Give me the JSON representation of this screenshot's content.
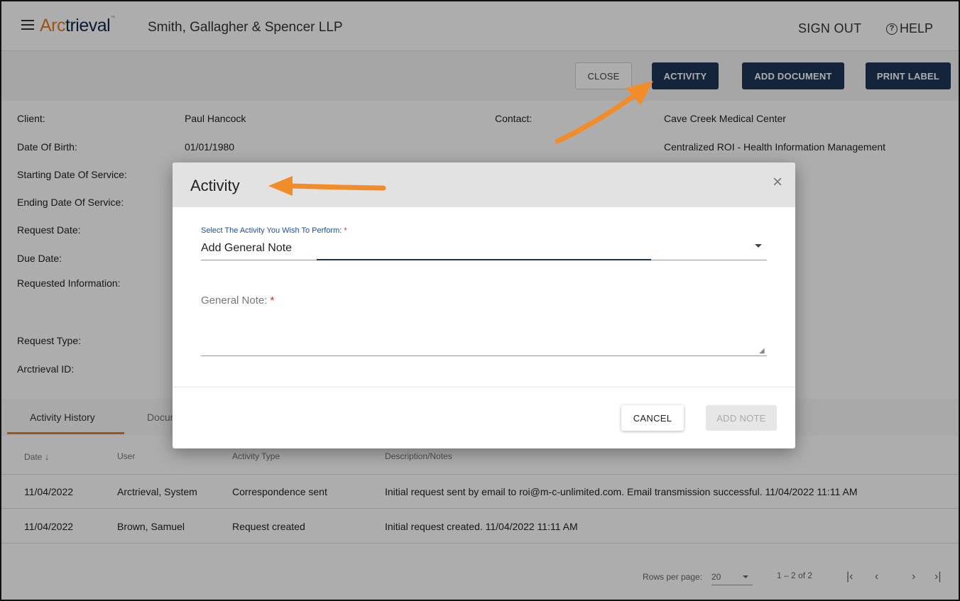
{
  "app": {
    "logo_part1": "Arc",
    "logo_part2": "trieval",
    "firm_name": "Smith, Gallagher & Spencer LLP",
    "sign_out": "SIGN OUT",
    "help": "HELP"
  },
  "actions": {
    "close": "CLOSE",
    "activity": "ACTIVITY",
    "add_document": "ADD DOCUMENT",
    "print_label": "PRINT LABEL"
  },
  "info": {
    "client_label": "Client:",
    "client_value": "Paul Hancock",
    "dob_label": "Date Of Birth:",
    "dob_value": "01/01/1980",
    "start_label": "Starting Date Of Service:",
    "end_label": "Ending Date Of Service:",
    "request_date_label": "Request Date:",
    "due_date_label": "Due Date:",
    "requested_info_label": "Requested Information:",
    "request_type_label": "Request Type:",
    "arctrieval_id_label": "Arctrieval ID:",
    "contact_label": "Contact:",
    "contact_value": "Cave Creek Medical Center",
    "contact_dept": "Centralized ROI - Health Information Management"
  },
  "tabs": {
    "activity_history": "Activity History",
    "documents": "Docum"
  },
  "table": {
    "headers": [
      "Date",
      "User",
      "Activity Type",
      "Description/Notes"
    ],
    "rows": [
      [
        "11/04/2022",
        "Arctrieval, System",
        "Correspondence sent",
        "Initial request sent by email to roi@m-c-unlimited.com. Email transmission successful. 11/04/2022 11:11 AM"
      ],
      [
        "11/04/2022",
        "Brown, Samuel",
        "Request created",
        "Initial request created. 11/04/2022 11:11 AM"
      ]
    ]
  },
  "pager": {
    "rows_per_page_label": "Rows per page:",
    "rows_per_page_value": "20",
    "range": "1 – 2 of 2"
  },
  "dialog": {
    "title": "Activity",
    "select_label": "Select The Activity You Wish To Perform:",
    "select_value": "Add General Note",
    "note_label": "General Note:",
    "required_mark": "*",
    "cancel": "CANCEL",
    "add_note": "ADD NOTE"
  },
  "colors": {
    "brand_orange": "#ea7b1f",
    "brand_navy": "#1d3557",
    "annotation_arrow": "#f28c28"
  }
}
